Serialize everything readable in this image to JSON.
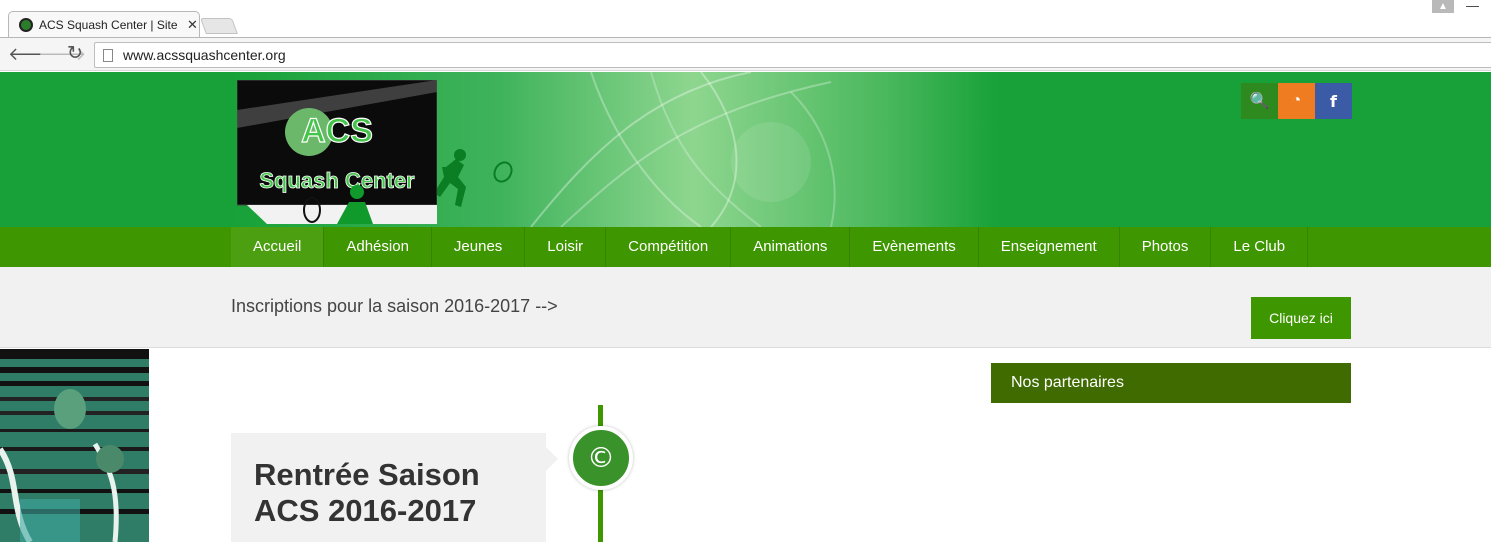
{
  "browser": {
    "tab_title": "ACS Squash Center | Site c",
    "tab_close": "✕",
    "url": "www.acssquashcenter.org"
  },
  "logo": {
    "line1": "ACS",
    "line2": "Squash Center"
  },
  "social": {
    "search": "🔍",
    "rss": "◔",
    "facebook": "f"
  },
  "nav": {
    "items": [
      "Accueil",
      "Adhésion",
      "Jeunes",
      "Loisir",
      "Compétition",
      "Animations",
      "Evènements",
      "Enseignement",
      "Photos",
      "Le Club"
    ],
    "active_index": 0
  },
  "notice": {
    "text": "Inscriptions pour la saison 2016-2017 -->",
    "button": "Cliquez ici"
  },
  "post": {
    "title": "Rentrée Saison ACS 2016-2017",
    "badge": "©"
  },
  "sidebar": {
    "partners_title": "Nos partenaires"
  },
  "colors": {
    "header_green": "#17a138",
    "nav_green": "#3e9600",
    "partners_green": "#3f6b00",
    "rss_orange": "#ef7c20",
    "facebook_blue": "#3b5ba7"
  }
}
